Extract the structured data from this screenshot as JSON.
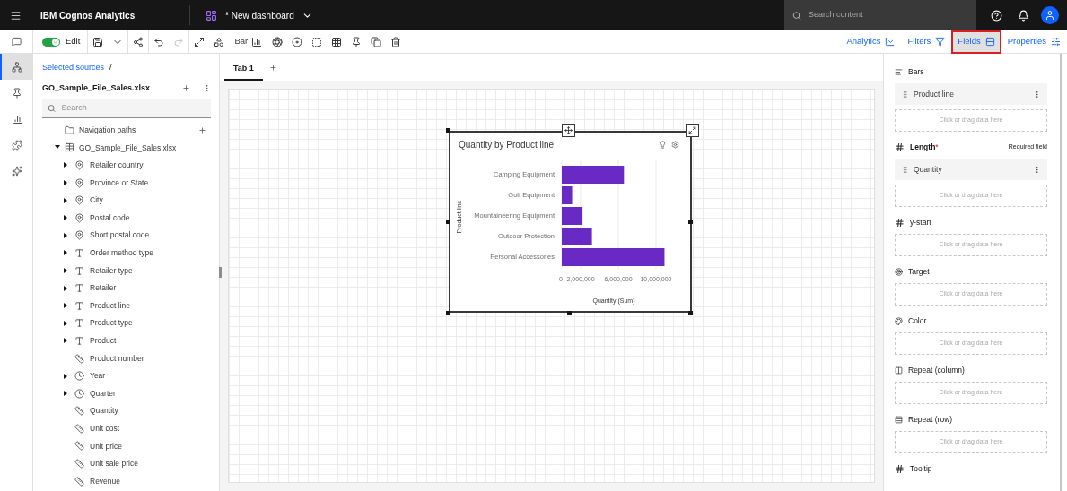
{
  "app_bar": {
    "title": "IBM Cognos Analytics",
    "dashboard_title": "* New dashboard",
    "search_placeholder": "Search content"
  },
  "rail": [
    {
      "kind": "sources",
      "selected": true
    },
    {
      "kind": "pin",
      "selected": false
    },
    {
      "kind": "visualizations",
      "selected": false
    },
    {
      "kind": "widgets",
      "selected": false
    },
    {
      "kind": "assistant",
      "selected": false
    }
  ],
  "toolbar": {
    "edit": {
      "label": "Edit",
      "on": true
    },
    "redo_disabled": true,
    "chart_type": "Bar"
  },
  "panel_tabs": [
    {
      "label": "Analytics",
      "kind": "analytics",
      "selected": false
    },
    {
      "label": "Filters",
      "kind": "filters",
      "selected": false
    },
    {
      "label": "Fields",
      "kind": "fields",
      "selected": true
    },
    {
      "label": "Properties",
      "kind": "properties",
      "selected": false
    }
  ],
  "sources": {
    "breadcrumb": "Selected sources",
    "separator": "/",
    "name": "GO_Sample_File_Sales.xlsx",
    "search_placeholder": "Search",
    "tree": [
      {
        "label": "Navigation paths",
        "kind": "folder"
      },
      {
        "label": "GO_Sample_File_Sales.xlsx",
        "kind": "table",
        "expanded": true,
        "children": [
          {
            "label": "Retailer country",
            "kind": "location",
            "expandable": true
          },
          {
            "label": "Province or State",
            "kind": "location",
            "expandable": true
          },
          {
            "label": "City",
            "kind": "location",
            "expandable": true
          },
          {
            "label": "Postal code",
            "kind": "location",
            "expandable": true
          },
          {
            "label": "Short postal code",
            "kind": "location",
            "expandable": true
          },
          {
            "label": "Order method type",
            "kind": "text",
            "expandable": true
          },
          {
            "label": "Retailer type",
            "kind": "text",
            "expandable": true
          },
          {
            "label": "Retailer",
            "kind": "text",
            "expandable": true
          },
          {
            "label": "Product line",
            "kind": "text",
            "expandable": true
          },
          {
            "label": "Product type",
            "kind": "text",
            "expandable": true
          },
          {
            "label": "Product",
            "kind": "text",
            "expandable": true
          },
          {
            "label": "Product number",
            "kind": "measure",
            "expandable": false
          },
          {
            "label": "Year",
            "kind": "time",
            "expandable": true
          },
          {
            "label": "Quarter",
            "kind": "time",
            "expandable": true
          },
          {
            "label": "Quantity",
            "kind": "measure",
            "expandable": false
          },
          {
            "label": "Unit cost",
            "kind": "measure",
            "expandable": false
          },
          {
            "label": "Unit price",
            "kind": "measure",
            "expandable": false
          },
          {
            "label": "Unit sale price",
            "kind": "measure",
            "expandable": false
          },
          {
            "label": "Revenue",
            "kind": "measure",
            "expandable": false
          }
        ]
      }
    ]
  },
  "tabs": [
    {
      "label": "Tab 1",
      "selected": true
    }
  ],
  "widget": {
    "title": "Quantity by Product line",
    "chart_data": {
      "type": "bar",
      "orientation": "horizontal",
      "xlabel": "Quantity (Sum)",
      "ylabel": "Product line",
      "categories": [
        "Camping Equipment",
        "Golf Equipment",
        "Mountaineering Equipment",
        "Outdoor Protection",
        "Personal Accessories"
      ],
      "series": [
        {
          "color": "#6929c4",
          "values": [
            6600000,
            1100000,
            2200000,
            3200000,
            10900000
          ]
        }
      ],
      "grid": true,
      "xlim": [
        0,
        11000000
      ],
      "xticks": [
        0,
        {
          "value": 2000000,
          "label": "2,000,000"
        },
        {
          "value": 6000000,
          "label": "6,000,000"
        },
        {
          "value": 10000000,
          "label": "10,000,000"
        }
      ]
    }
  },
  "slots": [
    {
      "label": "Bars",
      "kind": "bars",
      "fields": [
        "Product line"
      ],
      "placeholder": "Click or drag data here"
    },
    {
      "label": "Length",
      "kind": "number",
      "required_mark": "*",
      "required_note": "Required field",
      "fields": [
        "Quantity"
      ],
      "placeholder": "Click or drag data here"
    },
    {
      "label": "y-start",
      "kind": "number",
      "placeholder": "Click or drag data here"
    },
    {
      "label": "Target",
      "kind": "target",
      "placeholder": "Click or drag data here"
    },
    {
      "label": "Color",
      "kind": "color",
      "placeholder": "Click or drag data here"
    },
    {
      "label": "Repeat (column)",
      "kind": "column",
      "placeholder": "Click or drag data here"
    },
    {
      "label": "Repeat (row)",
      "kind": "row",
      "placeholder": "Click or drag data here"
    },
    {
      "label": "Tooltip",
      "kind": "number"
    }
  ]
}
